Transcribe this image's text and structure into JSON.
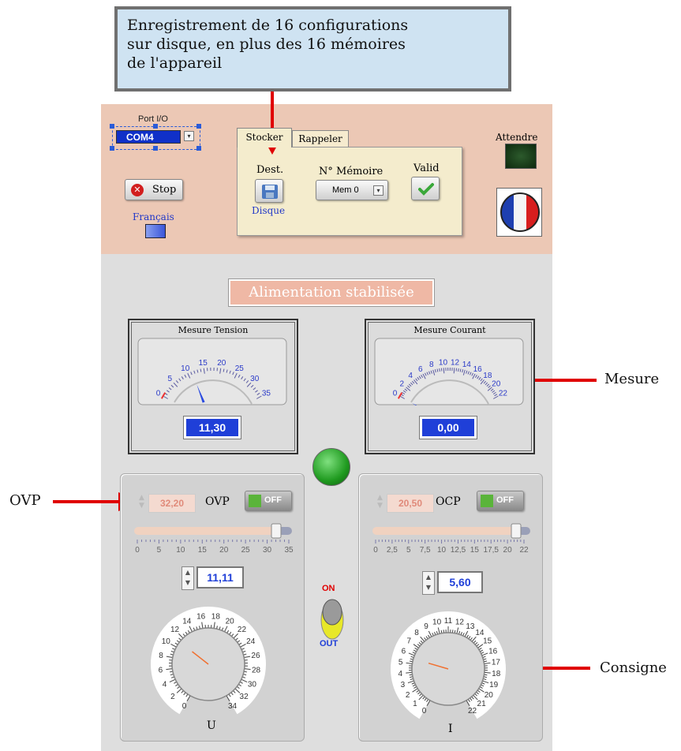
{
  "callout": {
    "line1": "Enregistrement de 16 configurations",
    "line2": "sur disque, en plus des 16 mémoires",
    "line3": "de l'appareil"
  },
  "top": {
    "port_label": "Port I/O",
    "port_value": "COM4",
    "stop_label": "Stop",
    "language_label": "Français",
    "tabs": [
      {
        "label": "Stocker"
      },
      {
        "label": "Rappeler"
      }
    ],
    "dest_label": "Dest.",
    "dest_value": "Disque",
    "memory_label": "N° Mémoire",
    "memory_value": "Mem 0",
    "valid_label": "Valid",
    "wait_label": "Attendre"
  },
  "title": "Alimentation stabilisée",
  "voltage_meter": {
    "label": "Mesure Tension",
    "value": "11,30",
    "ticks": [
      "0",
      "5",
      "10",
      "15",
      "20",
      "25",
      "30",
      "35"
    ]
  },
  "current_meter": {
    "label": "Mesure Courant",
    "value": "0,00",
    "ticks": [
      "0",
      "2",
      "4",
      "6",
      "8",
      "10",
      "12",
      "14",
      "16",
      "18",
      "20",
      "22"
    ]
  },
  "ovp": {
    "value": "32,20",
    "label": "OVP",
    "toggle": "OFF",
    "slider_ticks": [
      "0",
      "5",
      "10",
      "15",
      "20",
      "25",
      "30",
      "35"
    ],
    "setpoint": "11,11",
    "knob_label": "U",
    "knob_ticks": [
      "0",
      "2",
      "4",
      "6",
      "8",
      "10",
      "12",
      "14",
      "16",
      "18",
      "20",
      "22",
      "24",
      "26",
      "28",
      "30",
      "32",
      "34"
    ]
  },
  "ocp": {
    "value": "20,50",
    "label": "OCP",
    "toggle": "OFF",
    "slider_ticks": [
      "0",
      "2,5",
      "5",
      "7,5",
      "10",
      "12,5",
      "15",
      "17,5",
      "20",
      "22"
    ],
    "setpoint": "5,60",
    "knob_label": "I",
    "knob_ticks": [
      "0",
      "1",
      "2",
      "3",
      "4",
      "5",
      "6",
      "7",
      "8",
      "9",
      "10",
      "11",
      "12",
      "13",
      "14",
      "15",
      "16",
      "17",
      "18",
      "19",
      "20",
      "21",
      "22"
    ]
  },
  "output_switch": {
    "on_label": "ON",
    "out_label": "OUT"
  },
  "annotations": {
    "mesure": "Mesure",
    "ovp": "OVP",
    "consigne": "Consigne"
  },
  "colors": {
    "accent_blue": "#1f3fd8",
    "arrow_red": "#e00000",
    "led_green": "#2aa82a"
  }
}
